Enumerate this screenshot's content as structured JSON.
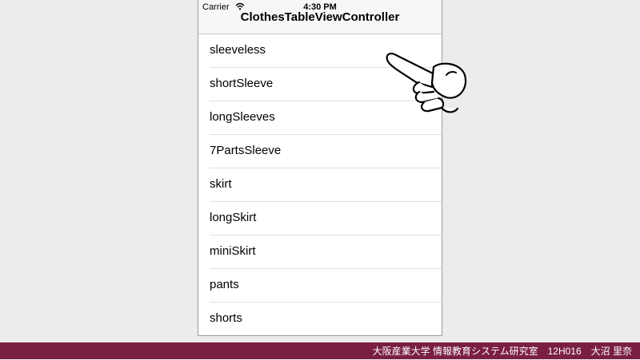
{
  "status_bar": {
    "carrier": "Carrier",
    "time": "4:30 PM"
  },
  "nav": {
    "title": "ClothesTableViewController"
  },
  "table": {
    "rows": [
      "sleeveless",
      "shortSleeve",
      "longSleeves",
      "7PartsSleeve",
      "skirt",
      "longSkirt",
      "miniSkirt",
      "pants",
      "shorts"
    ]
  },
  "icons": {
    "wifi": "wifi-icon",
    "pointer": "pointing-hand-icon"
  },
  "footer": {
    "text": "大阪産業大学 情報教育システム研究室　12H016　大沼 里奈"
  },
  "colors": {
    "footer_bg": "#7a1e44",
    "page_bg": "#ececec"
  }
}
